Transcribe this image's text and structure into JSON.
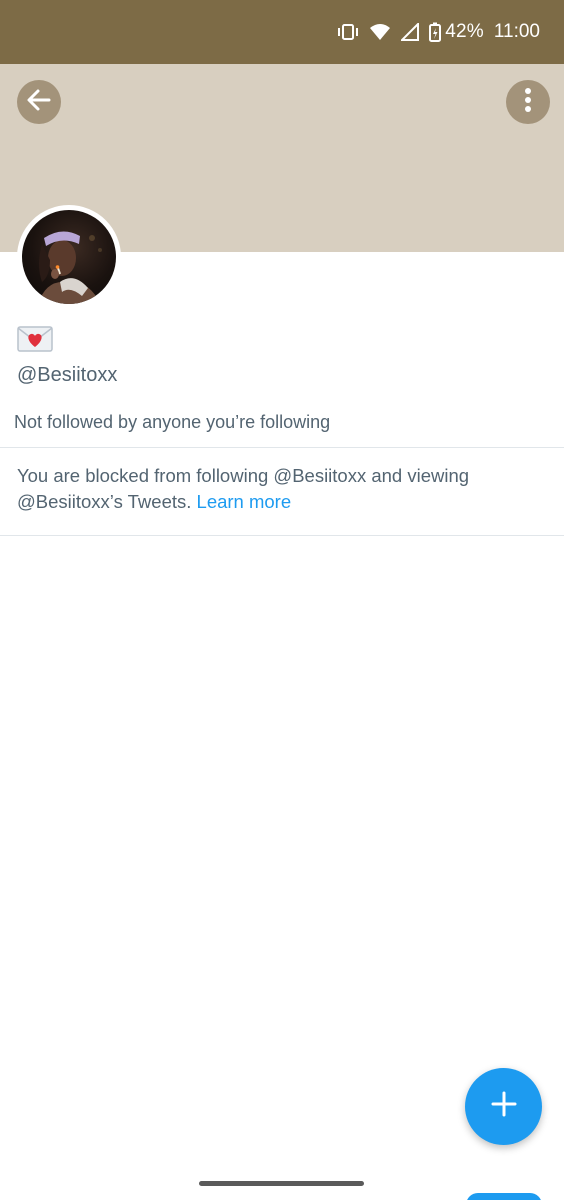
{
  "status_bar": {
    "battery": "42%",
    "time": "11:00",
    "icons": [
      "vibrate-icon",
      "wifi-icon",
      "signal-icon",
      "battery-charging-icon"
    ]
  },
  "header": {
    "back_icon": "arrow-left-icon",
    "more_icon": "more-vertical-icon",
    "banner_color": "#d8cfc0"
  },
  "profile": {
    "display_name_emoji": "💌",
    "handle": "@Besiitoxx",
    "followers_note": "Not followed by anyone you’re following"
  },
  "blocked_notice": {
    "text": "You are blocked from following @Besiitoxx and viewing @Besiitoxx’s Tweets.",
    "link": "Learn more"
  },
  "fab": {
    "icon": "plus-icon",
    "color": "#1d9bf0"
  }
}
